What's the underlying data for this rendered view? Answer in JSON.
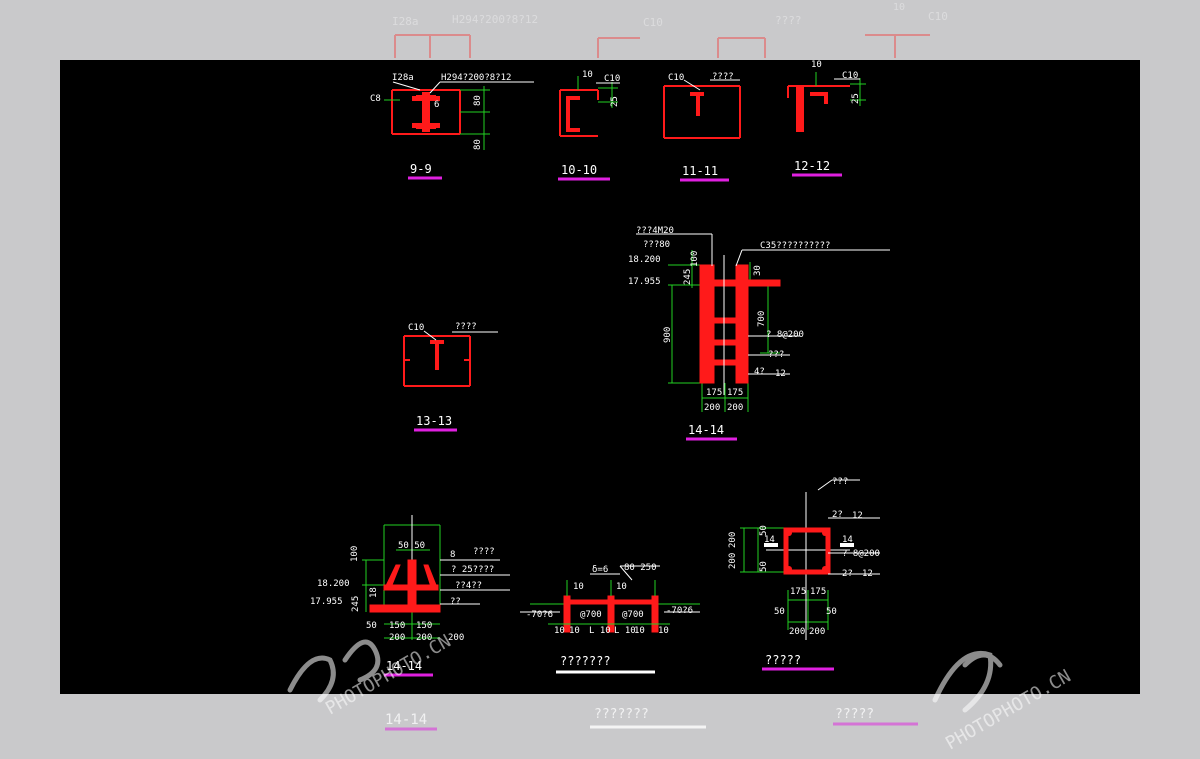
{
  "colors": {
    "outer_bg": "#c9c9cb",
    "canvas_bg": "#000000",
    "steel": "#ff1a1a",
    "dim": "#22d022",
    "text": "#ffffff",
    "underline_magenta": "#e020e0",
    "underline_white": "#ffffff"
  },
  "watermark": {
    "brand": "PHOTOPHOTO.CN"
  },
  "ghost_top": {
    "a": "I28a",
    "b": "H294?200?8?12",
    "c": "C10",
    "d": "????",
    "e": "10",
    "f": "C10"
  },
  "ghost_bottom": {
    "a": "14-14",
    "b": "???????",
    "c": "?????"
  },
  "sec9": {
    "title": "9-9",
    "l1": "I28a",
    "l2": "H294?200?8?12",
    "l3": "C8",
    "l4": "6",
    "d1": "80",
    "d2": "80"
  },
  "sec10": {
    "title": "10-10",
    "l1": "10",
    "l2": "C10",
    "d1": "25"
  },
  "sec11": {
    "title": "11-11",
    "l1": "C10",
    "l2": "????"
  },
  "sec12": {
    "title": "12-12",
    "l1": "10",
    "l2": "C10",
    "d1": "25"
  },
  "sec13": {
    "title": "13-13",
    "l1": "C10",
    "l2": "????"
  },
  "sec14a": {
    "title": "14-14",
    "l1": "???4M20",
    "l2": "???80",
    "e1": "18.200",
    "e2": "17.955",
    "d245": "245",
    "d100": "100",
    "d900": "900",
    "d30": "30",
    "d700": "700",
    "c35": "C35??????????",
    "bar": "? 8@200",
    "q3": "???",
    "four": "4?",
    "twelve": "12",
    "d175a": "175",
    "d175b": "175",
    "d200a": "200",
    "d200b": "200"
  },
  "sec14b": {
    "title": "14-14",
    "d5050": "50 50",
    "d100": "100",
    "e1": "18.200",
    "e2": "17.955",
    "d245": "245",
    "d18": "18",
    "d8": "8",
    "l1": "????",
    "l2": "? 25????",
    "l3": "??4??",
    "l4": "??",
    "d50": "50",
    "d150a": "150",
    "d150b": "150",
    "d200a": "200",
    "d200b": "200",
    "d200c": "200"
  },
  "secPlate": {
    "title": "???????",
    "t1": "δ=6",
    "t2": "80 250",
    "m1": "-70?6",
    "m2": "-70?6",
    "c1": "@700",
    "c2": "@700",
    "n1": "10",
    "n2": "10",
    "n3": "10",
    "n4": "10",
    "n5": "10",
    "n6": "10",
    "a1": "L 10",
    "a2": "L 10"
  },
  "secCol": {
    "title": "?????",
    "l1": "???",
    "two1": "2?",
    "twelve1": "12",
    "bar": "? 8@200",
    "two2": "2?",
    "twelve2": "12",
    "d200a": "200",
    "d200b": "200",
    "d50a": "50",
    "d50b": "50",
    "d14a": "14",
    "d14b": "14",
    "d175a": "175",
    "d175b": "175",
    "d50c": "50",
    "d50d": "50",
    "d200c": "200",
    "d200d": "200"
  }
}
